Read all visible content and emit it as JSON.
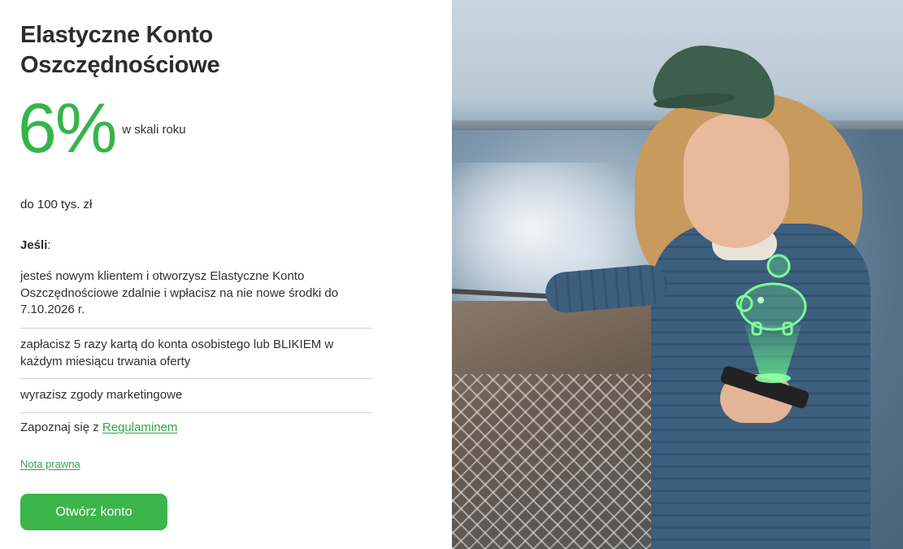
{
  "offer": {
    "title": "Elastyczne Konto Oszczędnościowe",
    "rate": "6%",
    "rate_caption": "w skali roku",
    "limit": "do 100 tys. zł",
    "if_label": "Jeśli",
    "if_colon": ":",
    "conditions": [
      "jesteś nowym klientem i otworzysz Elastyczne Konto Oszczędnościowe zdalnie i wpłacisz na nie nowe środki do 7.10.2026 r.",
      "zapłacisz 5 razy kartą do konta osobistego lub BLIKIEM w każdym miesiącu trwania oferty",
      "wyrazisz zgody marketingowe"
    ],
    "regulation_prefix": "Zapoznaj się z",
    "regulation_link": "Regulaminem",
    "legal_link": "Nota prawna",
    "cta_label": "Otwórz konto"
  },
  "colors": {
    "accent": "#35b54a",
    "button": "#3cb54a",
    "text": "#2d2d2d"
  },
  "icons": {
    "piggy_bank": "piggy-bank-hologram-icon"
  }
}
